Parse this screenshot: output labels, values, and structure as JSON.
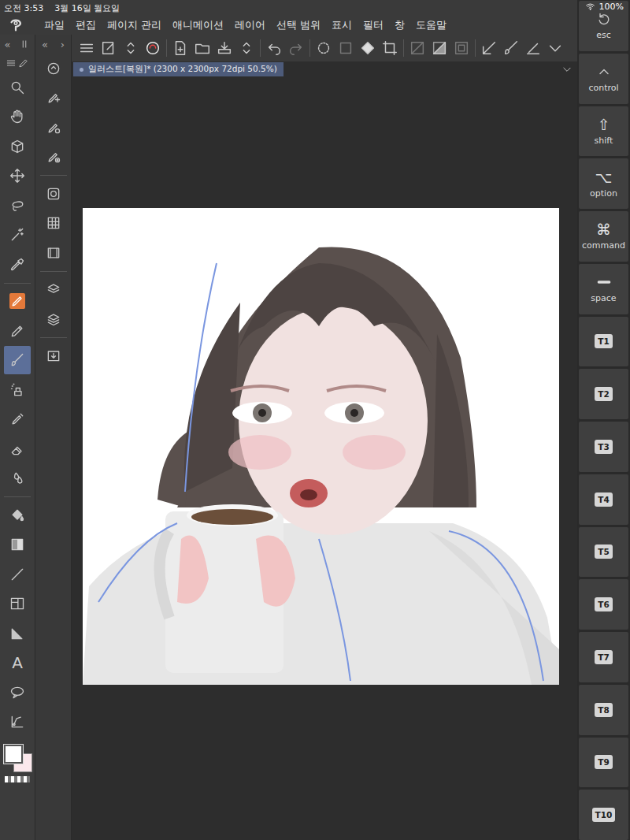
{
  "status_bar": {
    "time": "오전 3:53",
    "date": "3월 16일 월요일",
    "battery": "100%"
  },
  "menu": [
    "파일",
    "편집",
    "페이지 관리",
    "애니메이션",
    "레이어",
    "선택 범위",
    "표시",
    "필터",
    "창",
    "도움말"
  ],
  "panel_toggles": [
    "«",
    "«",
    "›"
  ],
  "document_tab": {
    "title": "일러스트[복원]* (2300 x 2300px 72dpi 50.5%)",
    "selected": true
  },
  "tools": [
    {
      "selected": false,
      "highlighted": false
    },
    {
      "selected": false,
      "highlighted": false
    },
    {
      "selected": false,
      "highlighted": false
    },
    {
      "selected": false,
      "highlighted": false
    },
    {
      "selected": false,
      "highlighted": false
    },
    {
      "selected": false,
      "highlighted": false
    },
    {
      "selected": false,
      "highlighted": false
    },
    {
      "selected": false,
      "highlighted": true
    },
    {
      "selected": false,
      "highlighted": false
    },
    {
      "selected": true,
      "highlighted": false
    },
    {
      "selected": false,
      "highlighted": false
    },
    {
      "selected": false,
      "highlighted": false
    },
    {
      "selected": false,
      "highlighted": false
    },
    {
      "selected": false,
      "highlighted": false
    },
    {
      "selected": false,
      "highlighted": false
    },
    {
      "selected": false,
      "highlighted": false
    },
    {
      "selected": false,
      "highlighted": false
    },
    {
      "selected": false,
      "highlighted": false
    },
    {
      "selected": false,
      "highlighted": false
    },
    {
      "selected": false,
      "highlighted": false
    },
    {
      "selected": false,
      "highlighted": false
    },
    {
      "selected": false,
      "highlighted": false
    }
  ],
  "text_tool_label": "A",
  "colors": {
    "main": "#ffffff",
    "sub": "#fbe8ec"
  },
  "keys": [
    {
      "label": "esc",
      "kind": "modifier"
    },
    {
      "label": "control",
      "kind": "modifier"
    },
    {
      "label": "shift",
      "kind": "modifier",
      "glyph": "⇧"
    },
    {
      "label": "option",
      "kind": "modifier",
      "glyph": "⌥"
    },
    {
      "label": "command",
      "kind": "modifier",
      "glyph": "⌘"
    },
    {
      "label": "space",
      "kind": "modifier"
    },
    {
      "label": "T1",
      "kind": "custom"
    },
    {
      "label": "T2",
      "kind": "custom"
    },
    {
      "label": "T3",
      "kind": "custom"
    },
    {
      "label": "T4",
      "kind": "custom"
    },
    {
      "label": "T5",
      "kind": "custom"
    },
    {
      "label": "T6",
      "kind": "custom"
    },
    {
      "label": "T7",
      "kind": "custom"
    },
    {
      "label": "T8",
      "kind": "custom"
    },
    {
      "label": "T9",
      "kind": "custom"
    },
    {
      "label": "T10",
      "kind": "custom"
    }
  ]
}
